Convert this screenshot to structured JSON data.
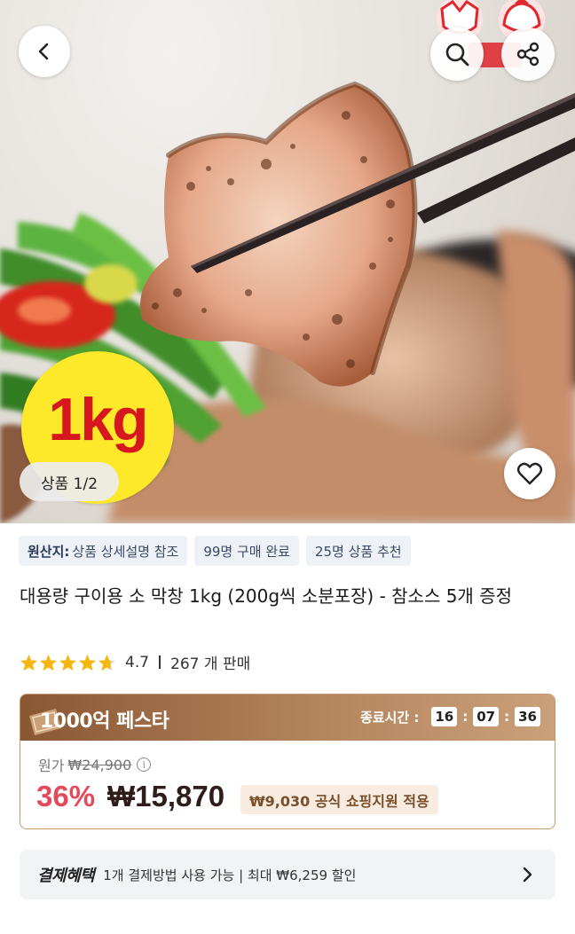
{
  "hero": {
    "weight_badge": "1kg",
    "page_counter": "상품 1/2"
  },
  "header": {
    "back_icon": "chevron-left-icon",
    "search_icon": "search-icon",
    "share_icon": "share-icon",
    "wishlist_icon": "heart-icon"
  },
  "info_chips": [
    {
      "strong": "원산지:",
      "text": "상품 상세설명 참조"
    },
    {
      "strong": "",
      "text": "99명 구매 완료"
    },
    {
      "strong": "",
      "text": "25명 상품 추천"
    }
  ],
  "product": {
    "title": "대용량 구이용 소 막창 1kg (200g씩 소분포장) - 참소스 5개 증정",
    "rating": "4.7",
    "stars": 4.7,
    "sales": "267 개 판매"
  },
  "festa": {
    "title": "1000억 페스타",
    "timer_label": "종료시간 :",
    "hours": "16",
    "minutes": "07",
    "seconds": "36",
    "original_label": "원가",
    "original_price": "₩24,900",
    "discount": "36%",
    "price": "₩15,870",
    "support": "₩9,030 공식 쇼핑지원 적용"
  },
  "payment": {
    "title": "결제혜택",
    "desc": "1개 결제방법 사용 가능 | 최대 ₩6,259 할인"
  },
  "colors": {
    "accent_red": "#e34a5c",
    "badge_yellow": "#fde82a",
    "festa_brown": "#8a5733",
    "star_yellow": "#f6b60e"
  }
}
